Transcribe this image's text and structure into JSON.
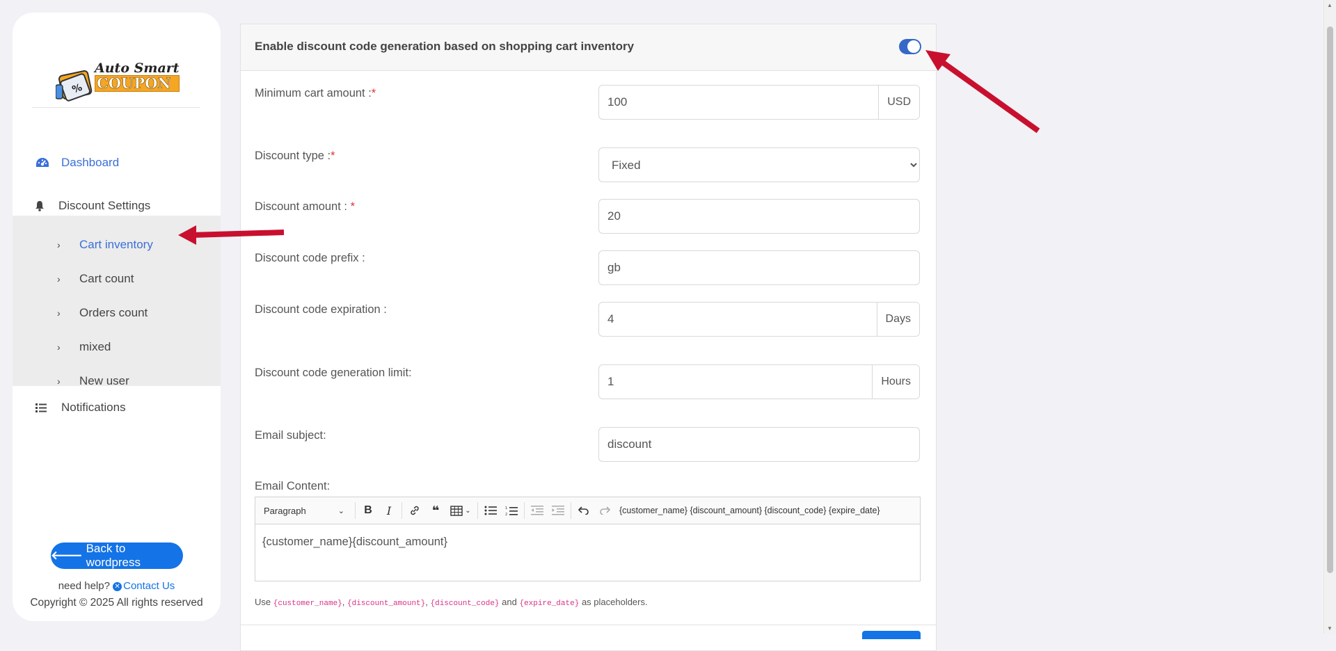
{
  "brand": {
    "line1": "Auto Smart",
    "line2": "COUPON"
  },
  "sidebar": {
    "items": [
      {
        "label": "Dashboard",
        "icon": "gauge-icon"
      },
      {
        "label": "Discount Settings",
        "icon": "bell-icon"
      },
      {
        "label": "Notifications",
        "icon": "list-icon"
      }
    ],
    "submenu": [
      {
        "label": "Cart inventory",
        "active": true
      },
      {
        "label": "Cart count"
      },
      {
        "label": "Orders count"
      },
      {
        "label": "mixed"
      },
      {
        "label": "New user"
      }
    ],
    "back_button": "Back to wordpress",
    "help_text": "need help?",
    "contact_label": "Contact Us",
    "copyright": "Copyright © 2025 All rights reserved"
  },
  "settings": {
    "title": "Enable discount code generation based on shopping cart inventory",
    "enabled": true,
    "min_cart_label": "Minimum cart amount :",
    "min_cart_value": "100",
    "min_cart_unit": "USD",
    "discount_type_label": "Discount type :",
    "discount_type_value": "Fixed",
    "discount_amount_label": "Discount amount : ",
    "discount_amount_value": "20",
    "prefix_label": "Discount code prefix :",
    "prefix_value": "gb",
    "expiration_label": "Discount code expiration :",
    "expiration_value": "4",
    "expiration_unit": "Days",
    "limit_label": "Discount code generation limit:",
    "limit_value": "1",
    "limit_unit": "Hours",
    "email_subject_label": "Email subject:",
    "email_subject_value": "discount",
    "email_content_label": "Email Content:",
    "required_mark": "*"
  },
  "editor": {
    "paragraph_label": "Paragraph",
    "placeholders_text": "{customer_name} {discount_amount} {discount_code} {expire_date}",
    "content": "{customer_name}{discount_amount}"
  },
  "hint": {
    "use": "Use",
    "p1": "{customer_name}",
    "p2": "{discount_amount}",
    "p3": "{discount_code}",
    "and": "and",
    "p4": "{expire_date}",
    "suffix": "as placeholders.",
    "comma": ","
  },
  "colors": {
    "accent": "#3568c8",
    "button_blue": "#1473e6",
    "annotation_red": "#c8102e",
    "required_red": "#e03434"
  }
}
